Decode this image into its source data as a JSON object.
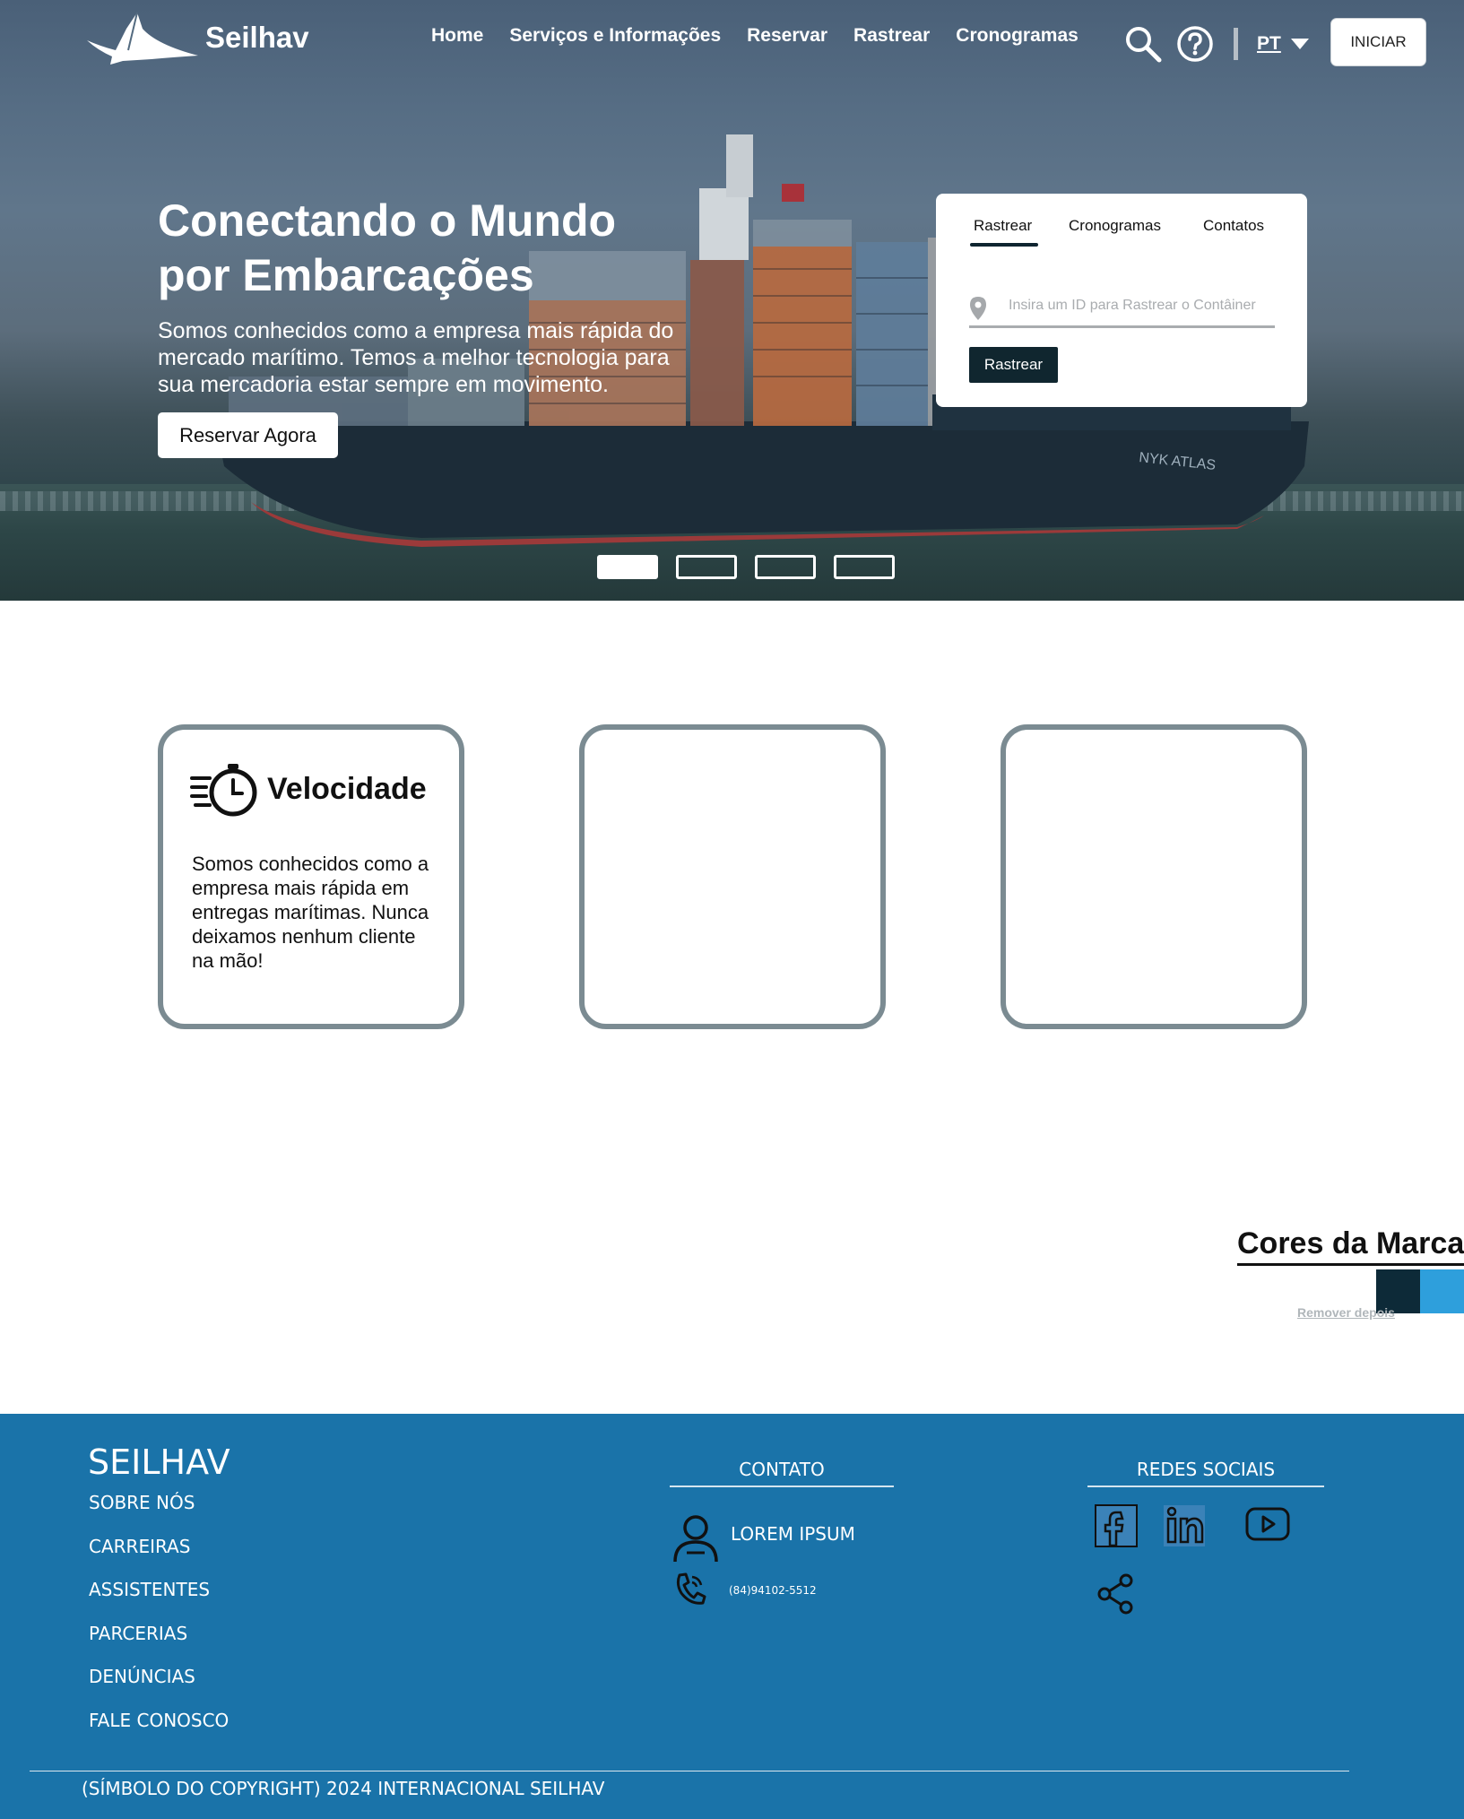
{
  "header": {
    "brand_name": "Seilhav",
    "nav": [
      "Home",
      "Serviços e Informações",
      "Reservar",
      "Rastrear",
      "Cronogramas"
    ],
    "language": "PT",
    "start_button": "INICIAR",
    "icons": [
      "logo-ray-icon",
      "search-icon",
      "help-icon",
      "caret-down-icon"
    ]
  },
  "hero": {
    "title": "Conectando o Mundo por Embarcações",
    "subtitle": "Somos conhecidos como a empresa mais rápida do mercado marítimo. Temos a melhor tecnologia para sua mercadoria estar sempre em movimento.",
    "cta": "Reservar Agora",
    "carousel": {
      "slides": 4,
      "active": 1
    }
  },
  "tracking": {
    "tabs": [
      "Rastrear",
      "Cronogramas",
      "Contatos"
    ],
    "active_tab": "Rastrear",
    "placeholder": "Insira um ID para Rastrear o Contâiner",
    "value": "",
    "button": "Rastrear",
    "icon": "map-pin-icon"
  },
  "features": [
    {
      "title": "Velocidade",
      "text": "Somos conhecidos como a empresa mais rápida em entregas marítimas. Nunca deixamos nenhum cliente na mão!",
      "icon": "stopwatch-speed-icon"
    },
    {
      "title": "",
      "text": ""
    },
    {
      "title": "",
      "text": ""
    }
  ],
  "brand_colors": {
    "title": "Cores da Marca",
    "swatches": [
      "#0d2a38",
      "#2e9fdc"
    ],
    "note": "Remover depois"
  },
  "footer": {
    "brand": "SEILHAV",
    "links": [
      "SOBRE NÓS",
      "CARREIRAS",
      "ASSISTENTES",
      "PARCERIAS",
      "DENÚNCIAS",
      "FALE CONOSCO"
    ],
    "contact_title": "CONTATO",
    "contact_name": "LOREM IPSUM",
    "contact_phone": "(84)94102-5512",
    "social_title": "REDES SOCIAIS",
    "social_icons": [
      "facebook-icon",
      "linkedin-icon",
      "youtube-icon",
      "share-icon"
    ],
    "copyright": "(SÍMBOLO DO COPYRIGHT) 2024 INTERNACIONAL SEILHAV",
    "background": "#1a73a9"
  }
}
